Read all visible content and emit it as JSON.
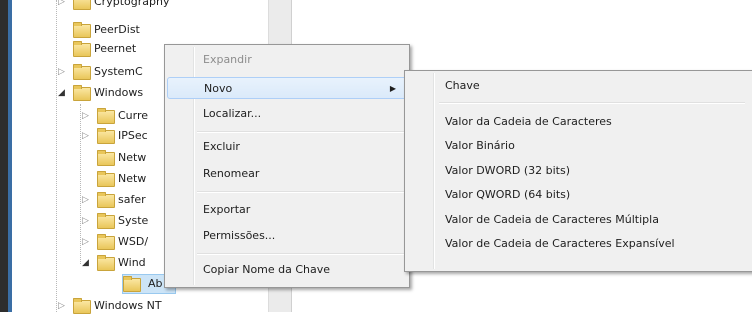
{
  "tree": {
    "items": [
      {
        "label": "Cryptography"
      },
      {
        "label": "PeerDist"
      },
      {
        "label": "Peernet"
      },
      {
        "label": "SystemC"
      },
      {
        "label": "Windows"
      },
      {
        "label": "Curre"
      },
      {
        "label": "IPSec"
      },
      {
        "label": "Netw"
      },
      {
        "label": "Netw"
      },
      {
        "label": "safer"
      },
      {
        "label": "Syste"
      },
      {
        "label": "WSD/"
      },
      {
        "label": "Wind"
      },
      {
        "label": "Ab"
      },
      {
        "label": "Windows NT"
      }
    ]
  },
  "context_menu": {
    "items": [
      {
        "label": "Expandir"
      },
      {
        "label": "Novo"
      },
      {
        "label": "Localizar..."
      },
      {
        "label": "Excluir"
      },
      {
        "label": "Renomear"
      },
      {
        "label": "Exportar"
      },
      {
        "label": "Permissões..."
      },
      {
        "label": "Copiar Nome da Chave"
      }
    ]
  },
  "submenu": {
    "items": [
      {
        "label": "Chave"
      },
      {
        "label": "Valor da Cadeia de Caracteres"
      },
      {
        "label": "Valor Binário"
      },
      {
        "label": "Valor DWORD (32 bits)"
      },
      {
        "label": "Valor QWORD (64 bits)"
      },
      {
        "label": "Valor de Cadeia de Caracteres Múltipla"
      },
      {
        "label": "Valor de Cadeia de Caracteres Expansível"
      }
    ]
  },
  "colors": {
    "menu_bg": "#f0f0f0",
    "highlight": "#dbeafa",
    "folder": "#e9c65a"
  }
}
